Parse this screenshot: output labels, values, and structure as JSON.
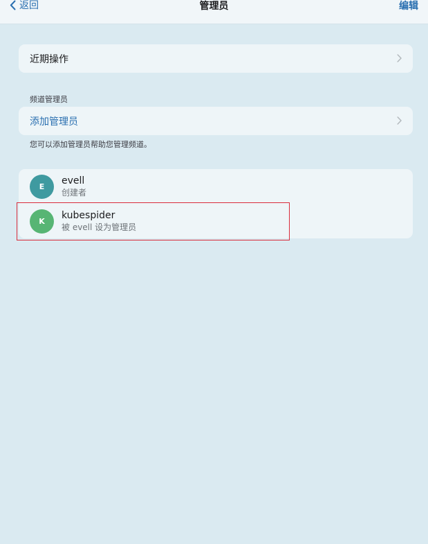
{
  "nav": {
    "back_label": "返回",
    "title": "管理员",
    "edit_label": "编辑"
  },
  "recent_actions": {
    "label": "近期操作"
  },
  "admins_section": {
    "header": "频道管理员",
    "add_label": "添加管理员",
    "footer": "您可以添加管理员帮助您管理频道。"
  },
  "members": [
    {
      "initial": "E",
      "name": "evell",
      "role": "创建者",
      "avatar_color": "#3f9aa0"
    },
    {
      "initial": "K",
      "name": "kubespider",
      "role": "被 evell 设为管理员",
      "avatar_color": "#57b574"
    }
  ],
  "colors": {
    "accent": "#2a6fb0",
    "background": "#daeaf1",
    "card": "#eef5f8",
    "highlight": "#d92b3a"
  },
  "icons": {
    "back": "chevron-left-icon",
    "row_disclosure": "chevron-right-icon"
  }
}
